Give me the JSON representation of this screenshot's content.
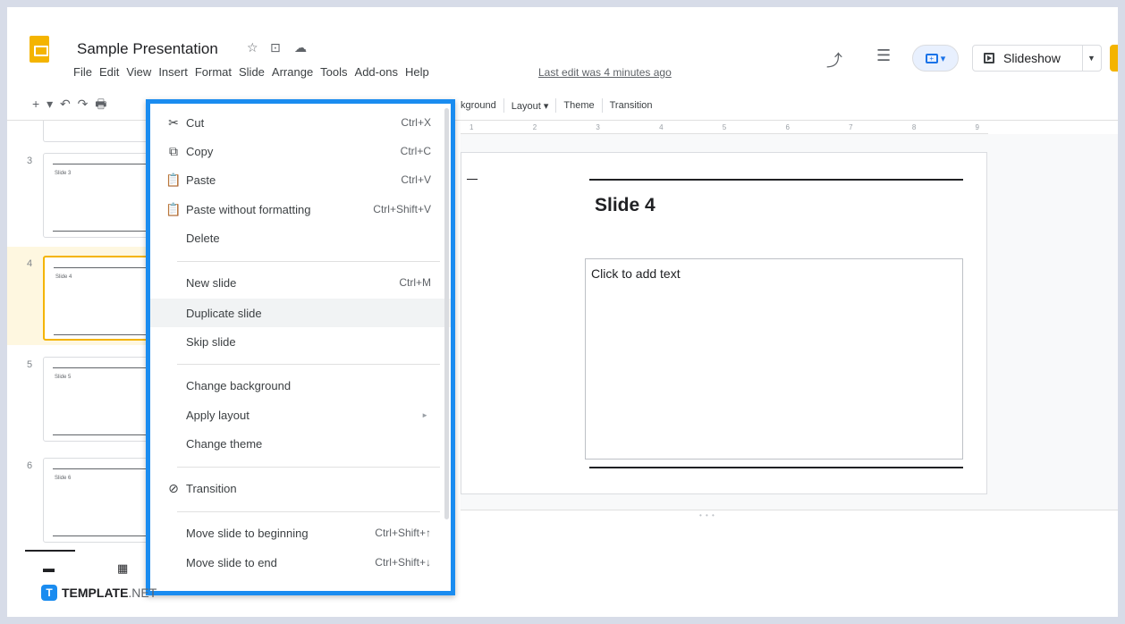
{
  "header": {
    "title": "Sample Presentation",
    "title_icons": [
      "☆",
      "⊡",
      "☁"
    ],
    "last_edit": "Last edit was 4 minutes ago",
    "slideshow_label": "Slideshow"
  },
  "menubar": [
    "File",
    "Edit",
    "View",
    "Insert",
    "Format",
    "Slide",
    "Arrange",
    "Tools",
    "Add-ons",
    "Help"
  ],
  "toolbar": {
    "left_glyphs": "+ ▾ ↶ ↷ 🖶",
    "background_label": "kground",
    "layout_label": "Layout ▾",
    "theme_label": "Theme",
    "transition_label": "Transition"
  },
  "ruler": [
    "1",
    "2",
    "3",
    "4",
    "5",
    "6",
    "7",
    "8",
    "9"
  ],
  "filmstrip": {
    "slides": [
      {
        "number": "3",
        "label": "Slide 3"
      },
      {
        "number": "4",
        "label": "Slide 4"
      },
      {
        "number": "5",
        "label": "Slide 5"
      },
      {
        "number": "6",
        "label": "Slide 6"
      }
    ]
  },
  "slide": {
    "title": "Slide 4",
    "body_placeholder": "Click to add text"
  },
  "context_menu": {
    "items": [
      {
        "label": "Cut",
        "shortcut": "Ctrl+X",
        "icon": "✂"
      },
      {
        "label": "Copy",
        "shortcut": "Ctrl+C",
        "icon": "⧉"
      },
      {
        "label": "Paste",
        "shortcut": "Ctrl+V",
        "icon": "📋"
      },
      {
        "label": "Paste without formatting",
        "shortcut": "Ctrl+Shift+V",
        "icon": "📋"
      },
      {
        "label": "Delete",
        "shortcut": ""
      },
      {
        "label": "New slide",
        "shortcut": "Ctrl+M"
      },
      {
        "label": "Duplicate slide",
        "shortcut": ""
      },
      {
        "label": "Skip slide",
        "shortcut": ""
      },
      {
        "label": "Change background",
        "shortcut": ""
      },
      {
        "label": "Apply layout",
        "shortcut": ""
      },
      {
        "label": "Change theme",
        "shortcut": ""
      },
      {
        "label": "Transition",
        "shortcut": "",
        "icon": "⊘"
      },
      {
        "label": "Move slide to beginning",
        "shortcut": "Ctrl+Shift+↑"
      },
      {
        "label": "Move slide to end",
        "shortcut": "Ctrl+Shift+↓"
      }
    ]
  },
  "watermark": {
    "brand": "TEMPLATE",
    "suffix": ".NET",
    "logo_letter": "T"
  },
  "colors": {
    "accent": "#1a8cf0",
    "selected_slide": "#f4b400"
  }
}
